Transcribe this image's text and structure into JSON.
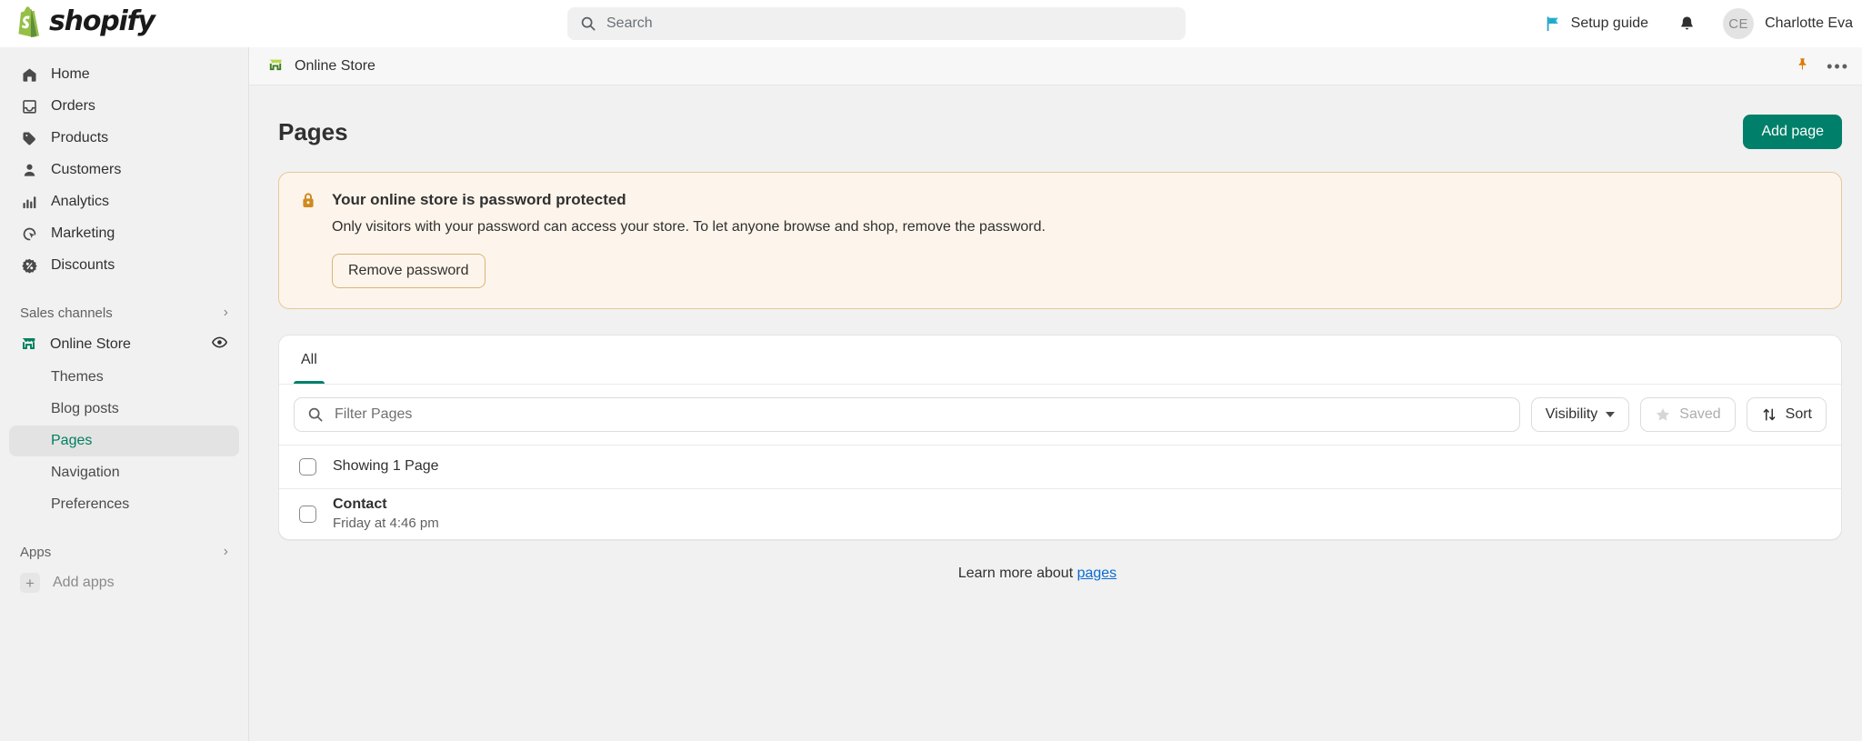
{
  "topbar": {
    "brand_name": "shopify",
    "search": {
      "placeholder": "Search",
      "icon": "search-icon"
    },
    "setup_guide_label": "Setup guide",
    "setup_guide_icon": "flag-icon",
    "notifications_icon": "bell-icon",
    "user": {
      "initials": "CE",
      "name": "Charlotte Eva"
    }
  },
  "sidebar": {
    "items": [
      {
        "label": "Home",
        "icon": "home-icon"
      },
      {
        "label": "Orders",
        "icon": "orders-icon"
      },
      {
        "label": "Products",
        "icon": "tag-icon"
      },
      {
        "label": "Customers",
        "icon": "person-icon"
      },
      {
        "label": "Analytics",
        "icon": "bar-chart-icon"
      },
      {
        "label": "Marketing",
        "icon": "marketing-icon"
      },
      {
        "label": "Discounts",
        "icon": "discount-icon"
      }
    ],
    "sales_channels": {
      "label": "Sales channels",
      "chevron": "chevron-right-icon"
    },
    "online_store": {
      "label": "Online Store",
      "icon": "storefront-icon",
      "view_icon": "eye-icon"
    },
    "online_store_children": [
      {
        "label": "Themes",
        "active": false
      },
      {
        "label": "Blog posts",
        "active": false
      },
      {
        "label": "Pages",
        "active": true
      },
      {
        "label": "Navigation",
        "active": false
      },
      {
        "label": "Preferences",
        "active": false
      }
    ],
    "apps": {
      "label": "Apps",
      "chevron": "chevron-right-icon"
    },
    "add_apps": {
      "label": "Add apps",
      "icon": "plus-icon"
    }
  },
  "context_bar": {
    "label": "Online Store",
    "icon": "storefront-icon",
    "pin_icon": "pin-icon",
    "more_icon": "ellipsis-icon"
  },
  "page": {
    "title": "Pages",
    "add_button": "Add page"
  },
  "banner": {
    "icon": "lock-icon",
    "title": "Your online store is password protected",
    "text": "Only visitors with your password can access your store. To let anyone browse and shop, remove the password.",
    "button": "Remove password",
    "bg_color": "#fdf5eb",
    "border_color": "#e5c89a",
    "icon_color": "#d08a1f"
  },
  "card": {
    "tabs": [
      {
        "label": "All",
        "active": true
      }
    ],
    "filter": {
      "placeholder": "Filter Pages",
      "icon": "search-icon",
      "visibility_label": "Visibility",
      "visibility_icon": "chevron-down-icon",
      "saved_label": "Saved",
      "saved_icon": "star-icon",
      "sort_label": "Sort",
      "sort_icon": "sort-arrows-icon"
    },
    "summary_row": {
      "label": "Showing 1 Page"
    },
    "rows": [
      {
        "title": "Contact",
        "subtitle": "Friday at 4:46 pm"
      }
    ]
  },
  "footer": {
    "learn_prefix": "Learn more about ",
    "learn_link": "pages"
  },
  "colors": {
    "accent_green": "#00806a",
    "link_blue": "#0a6cd0",
    "sidebar_bg": "#f1f1f1",
    "page_bg": "#f1f1f1"
  }
}
